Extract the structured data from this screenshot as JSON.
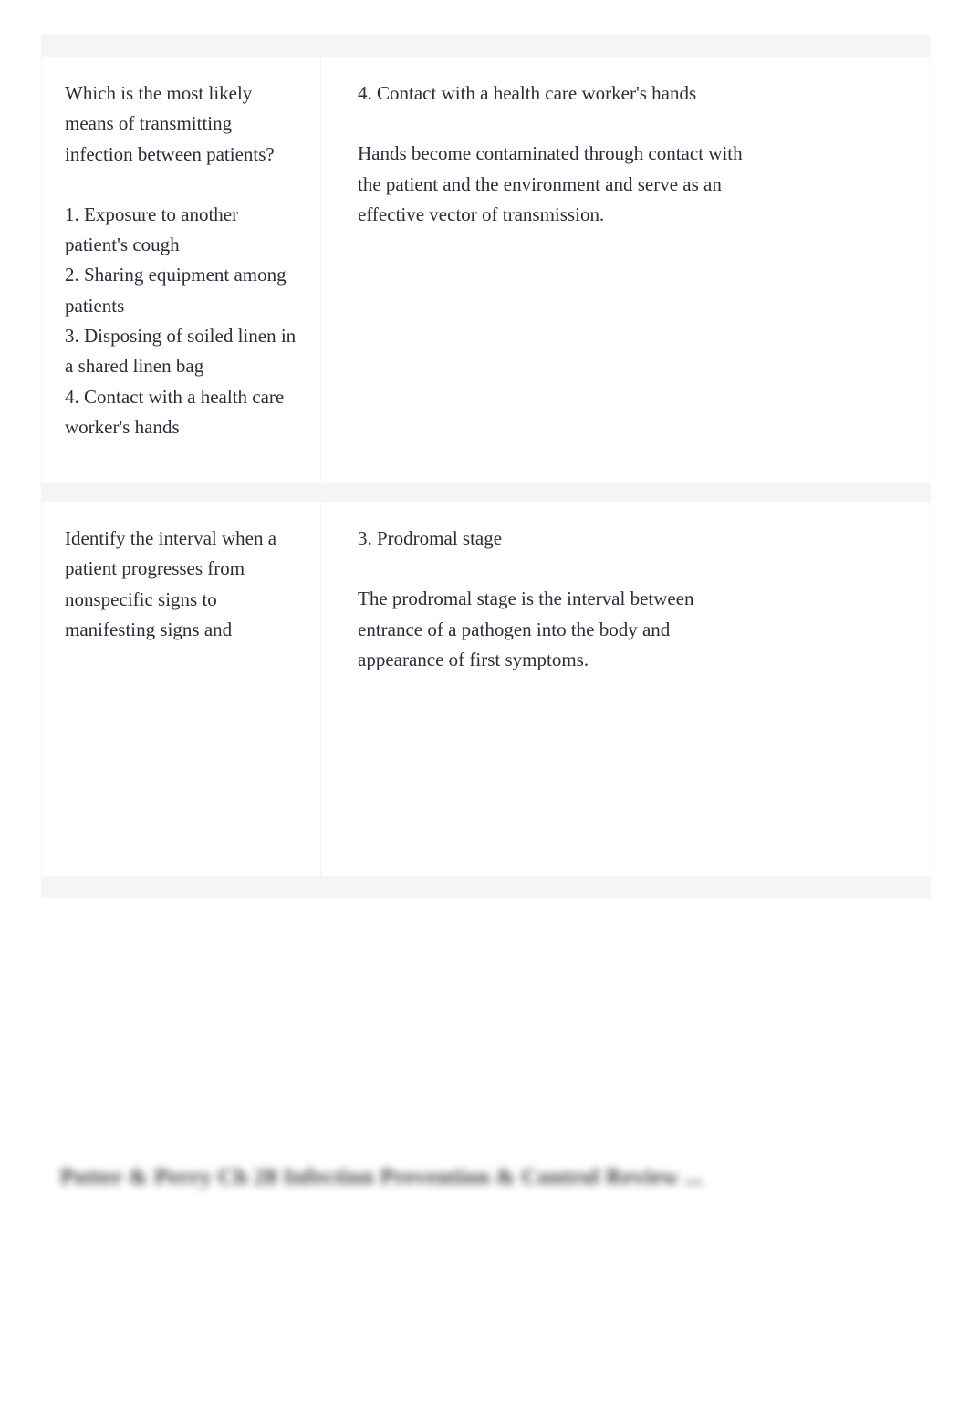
{
  "document": {
    "blurred_title": "Potter & Perry Ch 28 Infection Prevention & Control Review ..."
  },
  "cards": [
    {
      "question": {
        "prompt": "Which is the most likely means of transmitting infection between patients?",
        "options": [
          "1. Exposure to another patient's cough",
          "2. Sharing equipment among patients",
          "3. Disposing of soiled linen in a shared linen bag",
          "4. Contact with a health care worker's hands"
        ]
      },
      "answer": {
        "heading": "4. Contact with a health care worker's hands",
        "rationale": "Hands become contaminated through contact with the patient and the environment and serve as an effective vector of transmission."
      }
    },
    {
      "question": {
        "prompt": "Identify the interval when a patient progresses from nonspecific signs to manifesting signs and",
        "options": []
      },
      "answer": {
        "heading": "3. Prodromal stage",
        "rationale": "The prodromal stage is the interval between entrance of a pathogen into the body and appearance of first symptoms."
      }
    }
  ],
  "colors": {
    "page_background": "#ffffff",
    "card_background": "#ffffff",
    "band": "#f4f6f6",
    "text": "#2b2d3a",
    "divider": "#f2f2f2"
  }
}
